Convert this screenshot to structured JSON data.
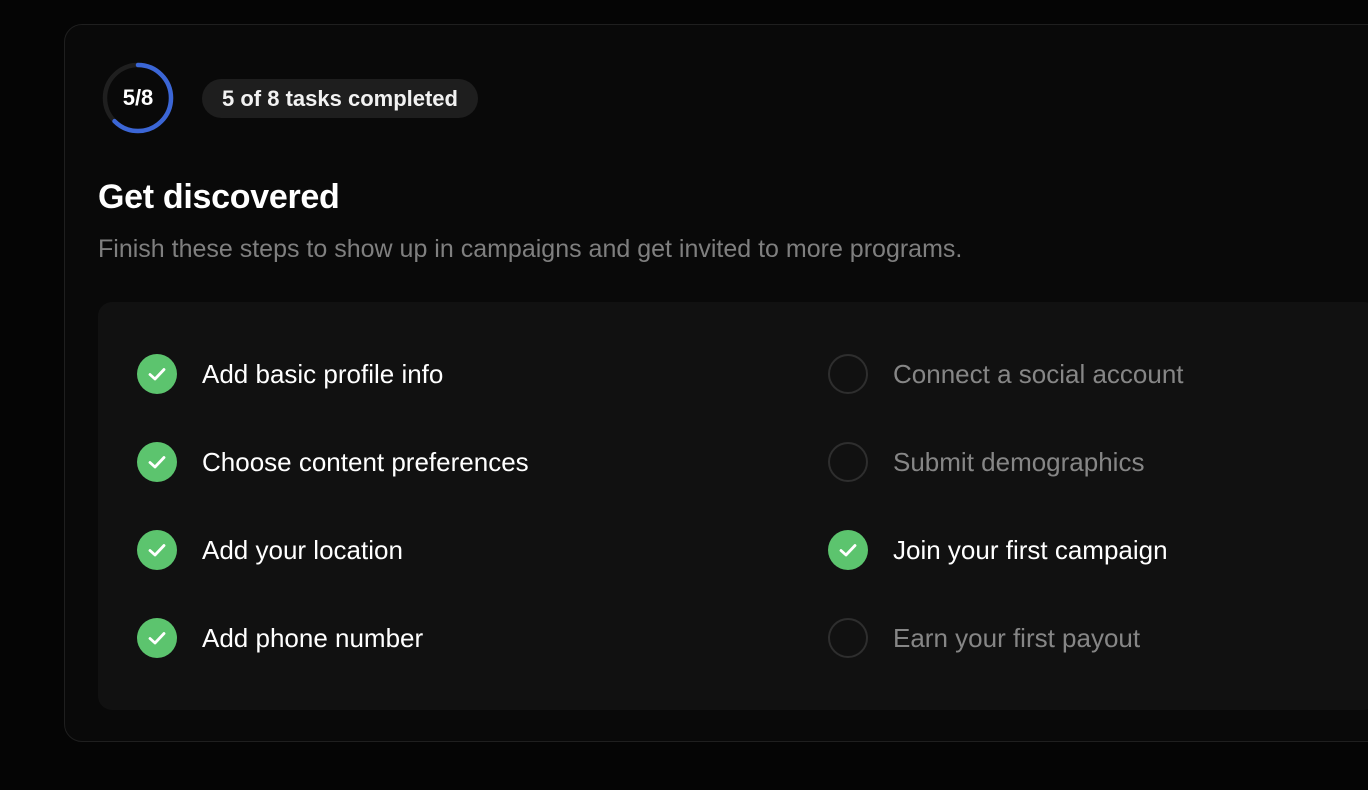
{
  "progress": {
    "label": "5/8",
    "completed": 5,
    "total": 8,
    "ring_color": "#3b66d6",
    "track_color": "#1f1f1f"
  },
  "status_pill": {
    "text": "5 of 8 tasks completed"
  },
  "header": {
    "title": "Get discovered",
    "subtitle": "Finish these steps to show up in campaigns and get invited to more programs."
  },
  "colors": {
    "done": "#5cc46e",
    "todo_border": "#2e2e2e"
  },
  "tasks": [
    {
      "label": "Add basic profile info",
      "done": true,
      "icon": "check-icon"
    },
    {
      "label": "Choose content preferences",
      "done": true,
      "icon": "check-icon"
    },
    {
      "label": "Add your location",
      "done": true,
      "icon": "check-icon"
    },
    {
      "label": "Add phone number",
      "done": true,
      "icon": "check-icon"
    },
    {
      "label": "Connect a social account",
      "done": false,
      "icon": "empty-circle-icon"
    },
    {
      "label": "Submit demographics",
      "done": false,
      "icon": "empty-circle-icon"
    },
    {
      "label": "Join your first campaign",
      "done": true,
      "icon": "check-icon"
    },
    {
      "label": "Earn your first payout",
      "done": false,
      "icon": "empty-circle-icon"
    }
  ]
}
